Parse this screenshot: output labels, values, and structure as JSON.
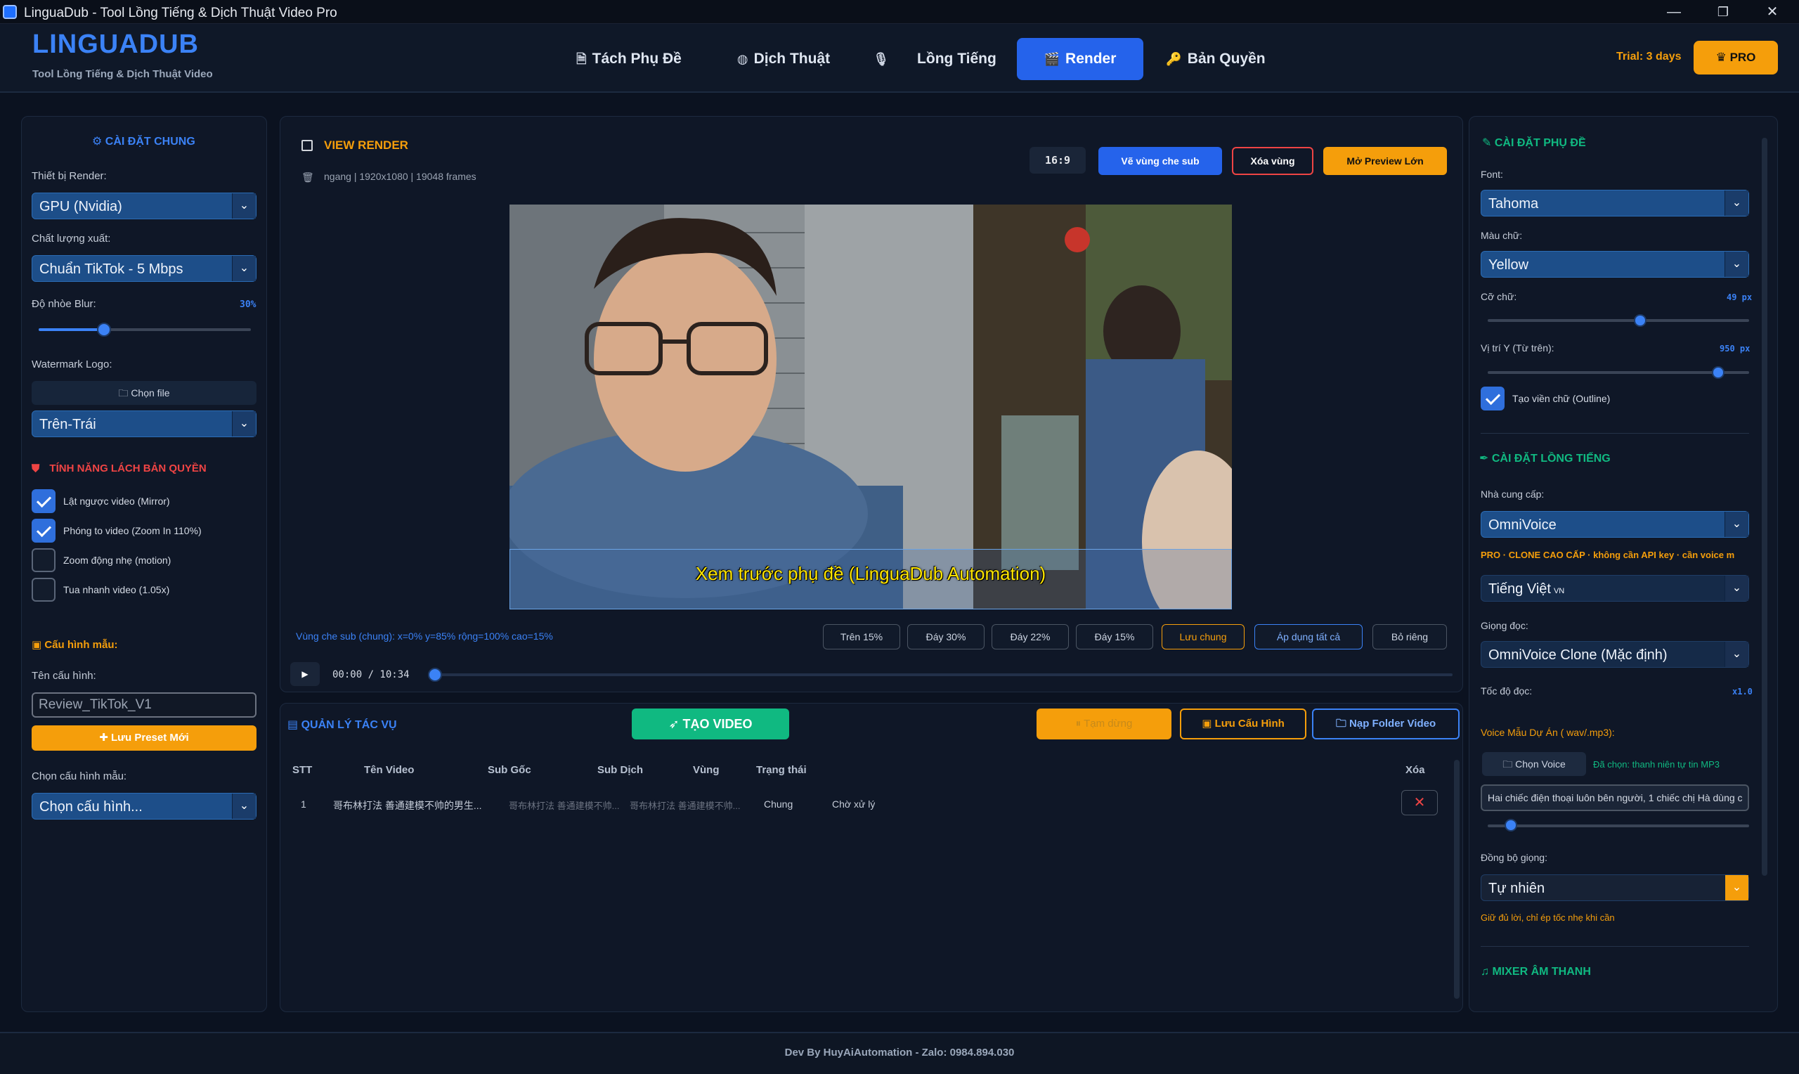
{
  "window": {
    "title": "LinguaDub - Tool Lồng Tiếng & Dịch Thuật Video Pro",
    "minimize": "—",
    "restore": "❐",
    "close": "✕"
  },
  "header": {
    "brand": "LINGUADUB",
    "brand_sub": "Tool Lồng Tiếng & Dịch Thuật Video",
    "tabs": [
      {
        "label": "Tách Phụ Đề",
        "icon": "document-icon"
      },
      {
        "label": "Dịch Thuật",
        "icon": "globe-icon"
      },
      {
        "label": "Lồng Tiếng",
        "icon": "microphone-icon"
      },
      {
        "label": "Render",
        "icon": "clapper-icon",
        "active": true
      },
      {
        "label": "Bản Quyền",
        "icon": "key-icon"
      }
    ],
    "trial": "Trial: 3 days",
    "pro": "PRO"
  },
  "left": {
    "title": "CÀI ĐẶT CHUNG",
    "device_label": "Thiết bị Render:",
    "device_value": "GPU (Nvidia)",
    "quality_label": "Chất lượng xuất:",
    "quality_value": "Chuẩn TikTok - 5 Mbps",
    "blur_label": "Độ nhòe Blur:",
    "blur_value": "30%",
    "blur_level": 0.3,
    "watermark_label": "Watermark Logo:",
    "choose_file": "Chọn file",
    "position_value": "Trên-Trái",
    "copyright_title": "TÍNH NĂNG LÁCH BẢN QUYỀN",
    "options": [
      {
        "label": "Lật ngược video (Mirror)",
        "checked": true
      },
      {
        "label": "Phóng to video (Zoom In 110%)",
        "checked": true
      },
      {
        "label": "Zoom động nhẹ (motion)",
        "checked": false
      },
      {
        "label": "Tua nhanh video (1.05x)",
        "checked": false
      }
    ],
    "preset_title": "Cấu hình mẫu:",
    "preset_name_label": "Tên cấu hình:",
    "preset_name_value": "Review_TikTok_V1",
    "save_preset": "Lưu Preset Mới",
    "choose_preset_label": "Chọn cấu hình mẫu:",
    "choose_preset_value": "Chọn cấu hình..."
  },
  "center": {
    "view_title": "VIEW RENDER",
    "video_info": "ngang | 1920x1080 | 19048 frames",
    "ratio": "16:9",
    "draw_zone": "Vẽ vùng che sub",
    "clear_zone": "Xóa vùng",
    "open_preview": "Mở Preview Lớn",
    "subtitle_preview": "Xem trước phụ đề (LinguaDub Automation)",
    "zone_info": "Vùng che sub (chung): x=0% y=85% rộng=100% cao=15%",
    "zone_buttons": [
      "Trên 15%",
      "Đáy 30%",
      "Đáy 22%",
      "Đáy 15%"
    ],
    "save_common": "Lưu chung",
    "apply_all": "Áp dụng tất cả",
    "skip_own": "Bỏ riêng",
    "play": "▶",
    "time": "00:00 / 10:34",
    "progress": 0.0
  },
  "tasks": {
    "title": "QUẢN LÝ TÁC VỤ",
    "create_video": "TẠO VIDEO",
    "pause": "Tạm dừng",
    "save_config": "Lưu Cấu Hình",
    "load_folder": "Nạp Folder Video",
    "columns": [
      "STT",
      "Tên Video",
      "Sub Gốc",
      "Sub Dịch",
      "Vùng",
      "Trạng thái",
      "Xóa"
    ],
    "rows": [
      {
        "stt": "1",
        "name": "哥布林打法 善通建模不帅的男生...",
        "sub_src": "哥布林打法 善通建模不帅...",
        "sub_dst": "哥布林打法 善通建模不帅...",
        "zone": "Chung",
        "status": "Chờ xử lý"
      }
    ]
  },
  "right": {
    "sub_title": "CÀI ĐẶT PHỤ ĐỀ",
    "font_label": "Font:",
    "font_value": "Tahoma",
    "color_label": "Màu chữ:",
    "color_value": "Yellow",
    "size_label": "Cỡ chữ:",
    "size_value": "49 px",
    "size_level": 0.58,
    "posy_label": "Vị trí Y (Từ trên):",
    "posy_value": "950 px",
    "posy_level": 0.88,
    "outline_label": "Tạo viền chữ (Outline)",
    "voice_title": "CÀI ĐẶT LỒNG TIẾNG",
    "provider_label": "Nhà cung cấp:",
    "provider_value": "OmniVoice",
    "pro_note": "PRO · CLONE CAO CẤP · không cần API key · cần voice m",
    "language_value": "Tiếng Việt",
    "language_flag": "VN",
    "voice_label": "Giọng đọc:",
    "voice_value": "OmniVoice Clone (Mặc định)",
    "speed_label": "Tốc độ đọc:",
    "speed_value": "x1.0",
    "sample_label": "Voice Mẫu Dự Án ( wav/.mp3):",
    "choose_voice": "Chọn Voice",
    "chosen_note": "Đã chọn: thanh niên tự tin MP3",
    "sample_text": "Hai chiếc điện thoại luôn bên người, 1 chiếc chị Hà dùng c",
    "sync_label": "Đồng bộ giọng:",
    "sync_value": "Tự nhiên",
    "sync_note": "Giữ đủ lời, chỉ ép tốc nhẹ khi cần",
    "mixer_title": "MIXER ÂM THANH"
  },
  "footer": {
    "text": "Dev By HuyAiAutomation - Zalo: 0984.894.030"
  },
  "colors": {
    "accent": "#2563eb",
    "warning": "#f59e0b",
    "success": "#10b981",
    "danger": "#ef4444",
    "bg": "#0b1220"
  }
}
